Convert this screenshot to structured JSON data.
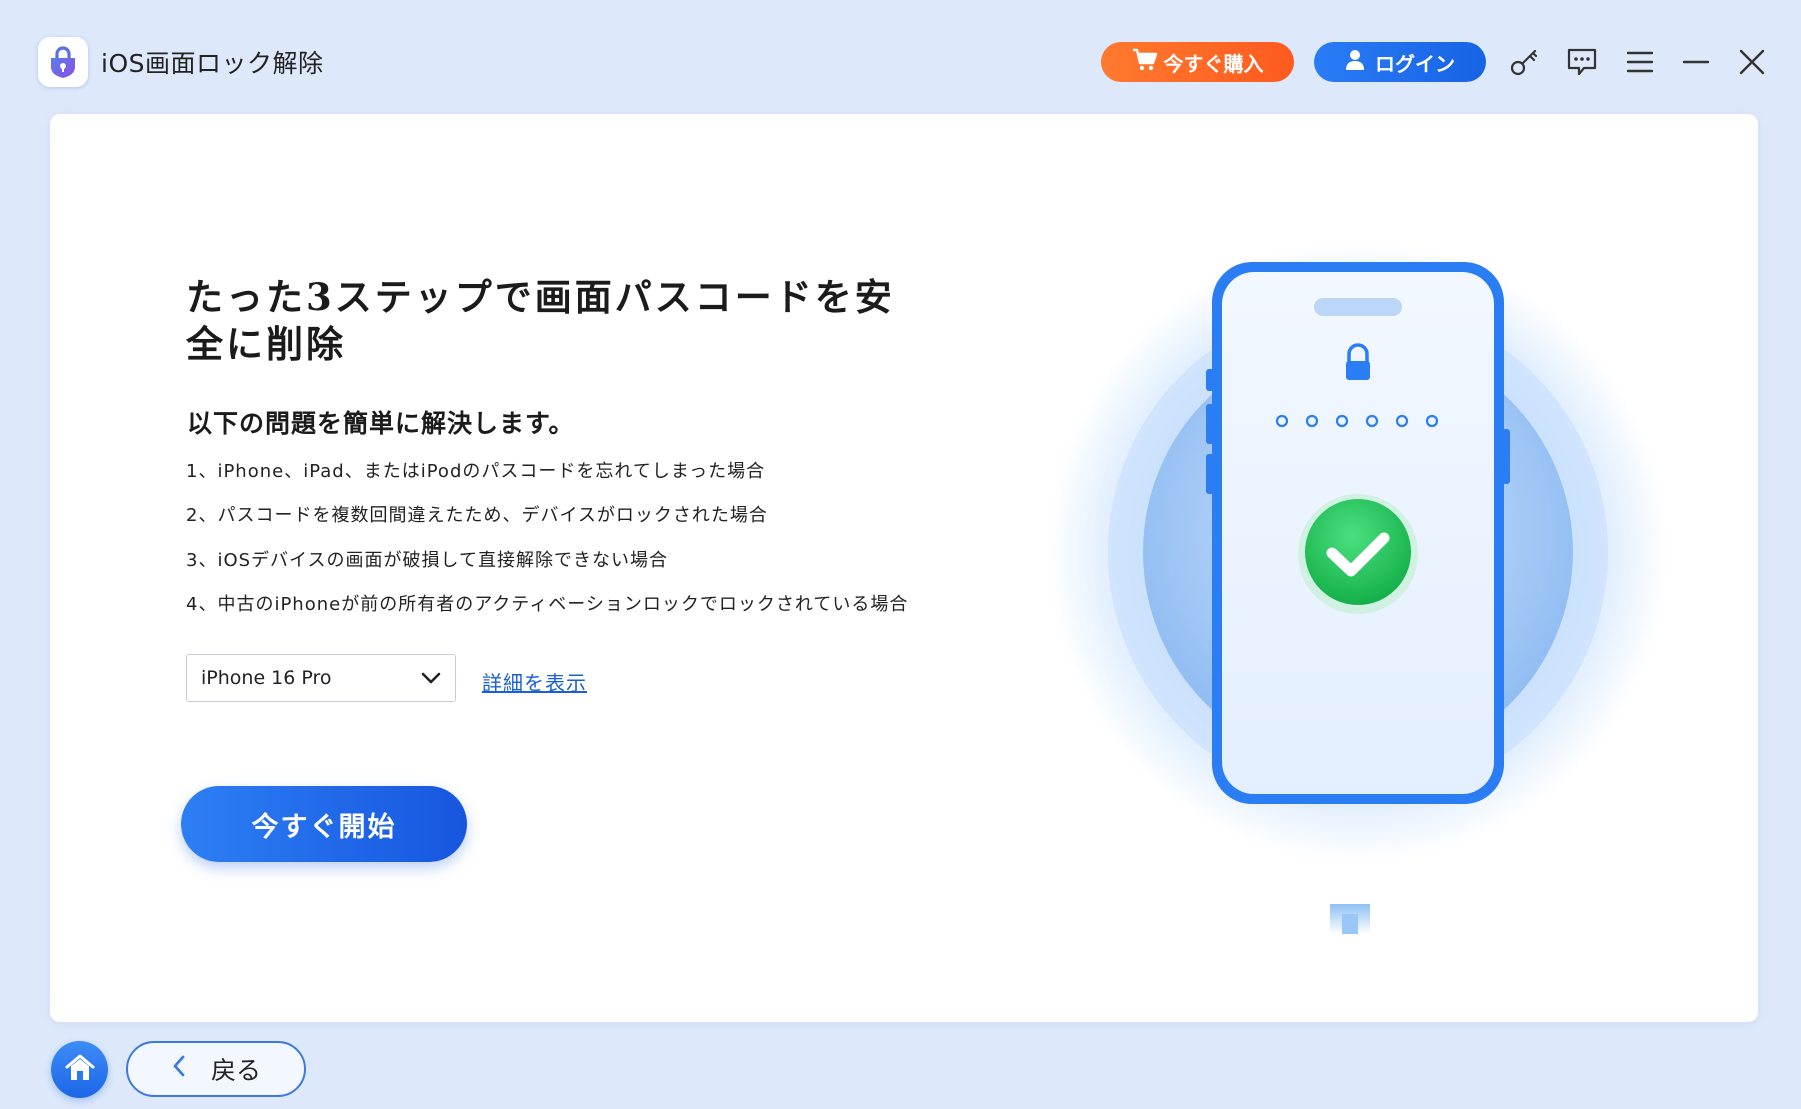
{
  "app": {
    "title": "iOS画面ロック解除",
    "logo_icon": "padlock-shield-icon"
  },
  "toolbar": {
    "buy_label": "今すぐ購入",
    "buy_icon": "cart-icon",
    "login_label": "ログイン",
    "login_icon": "user-icon",
    "icons": [
      "key-icon",
      "chat-icon",
      "menu-icon",
      "minimize-icon",
      "close-icon"
    ]
  },
  "main": {
    "headline": "たった3ステップで画面パスコードを安全に削除",
    "subheading": "以下の問題を簡単に解決します。",
    "issues": [
      "1、iPhone、iPad、またはiPodのパスコードを忘れてしまった場合",
      "2、パスコードを複数回間違えたため、デバイスがロックされた場合",
      "3、iOSデバイスの画面が破損して直接解除できない場合",
      "4、中古のiPhoneが前の所有者のアクティベーションロックでロックされている場合"
    ],
    "model_select": {
      "value": "iPhone 16 Pro"
    },
    "details_link": "詳細を表示",
    "start_button": "今すぐ開始"
  },
  "illustration": {
    "phone_icon": "phone-unlock-illustration",
    "check_icon": "check-circle-icon",
    "lock_icon": "lock-icon",
    "passcode_dots": 6
  },
  "footer": {
    "home_icon": "home-icon",
    "back_label": "戻る"
  },
  "colors": {
    "background": "#dde9fb",
    "accent_blue": "#1f6bea",
    "buy_orange": "#ff6a24",
    "success_green": "#22c25a"
  }
}
